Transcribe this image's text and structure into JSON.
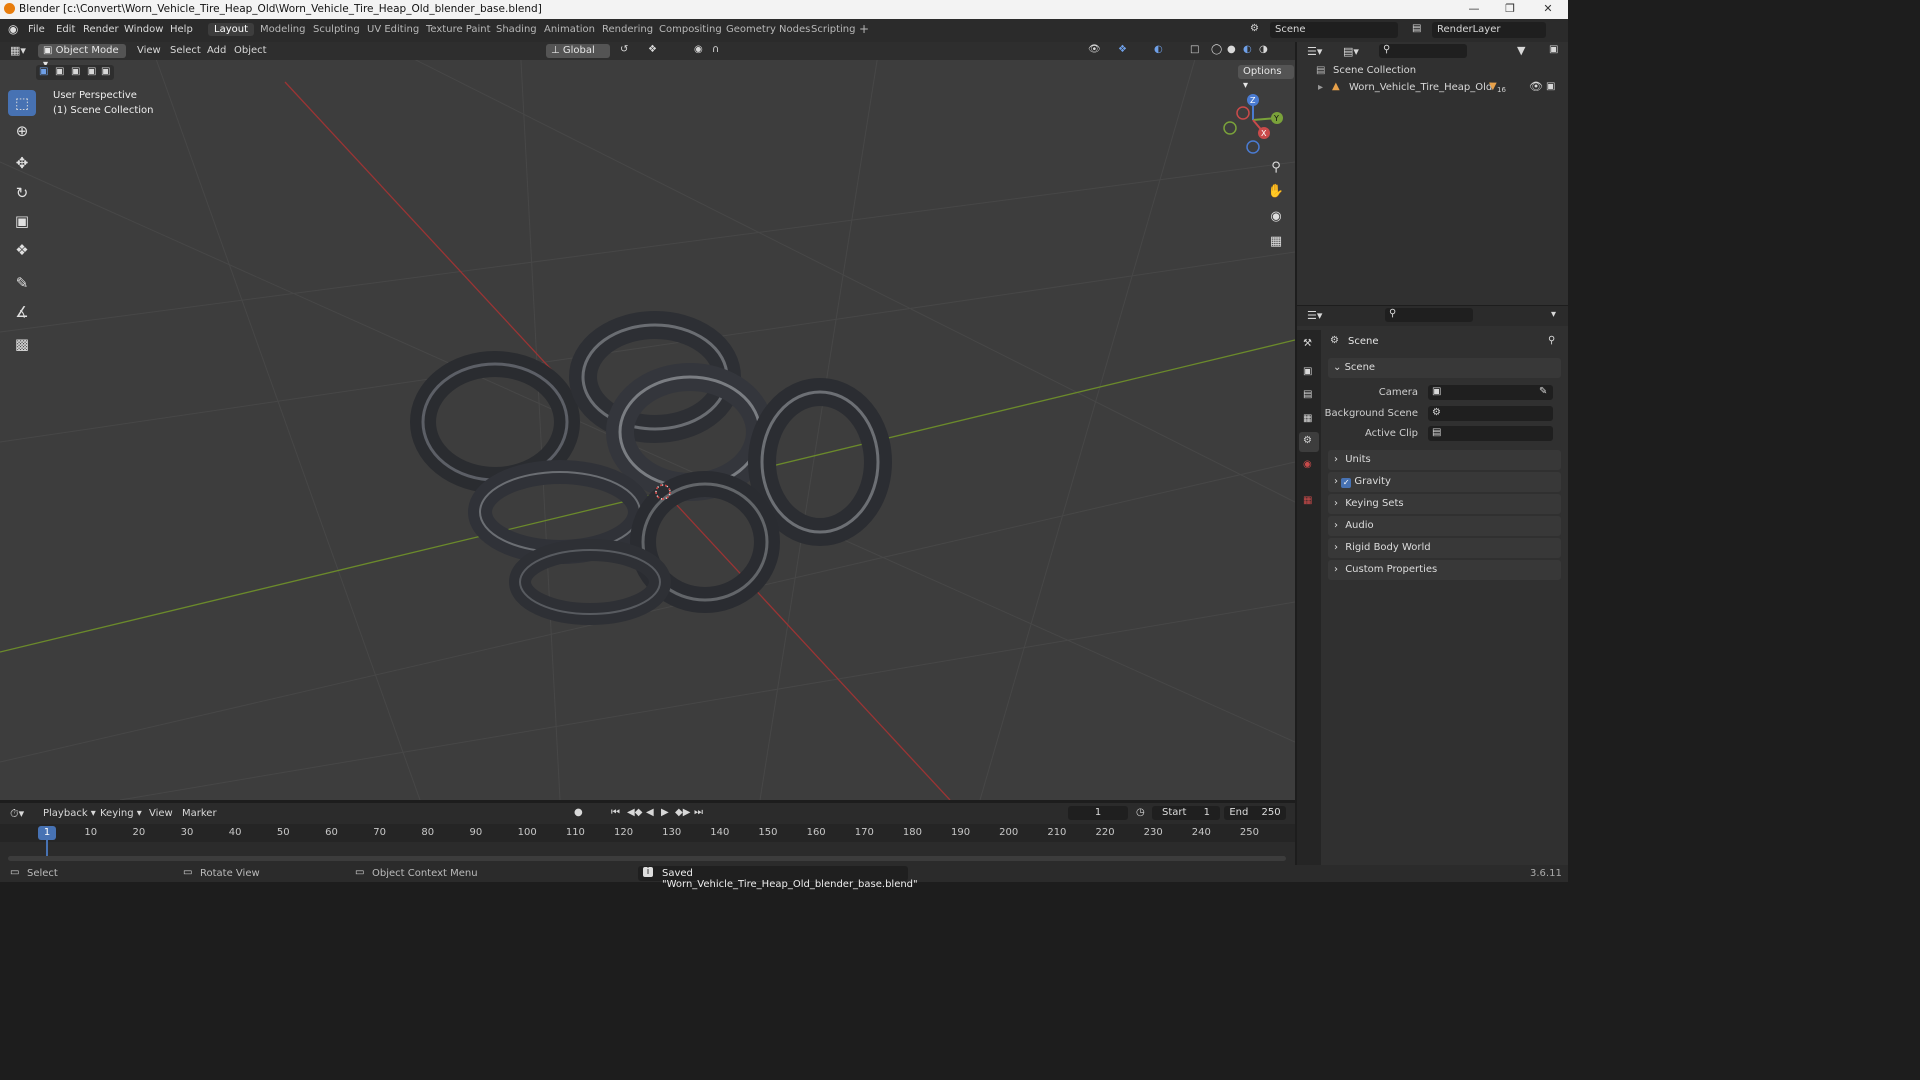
{
  "window": {
    "title": "Blender [c:\\Convert\\Worn_Vehicle_Tire_Heap_Old\\Worn_Vehicle_Tire_Heap_Old_blender_base.blend]"
  },
  "menu": [
    "File",
    "Edit",
    "Render",
    "Window",
    "Help"
  ],
  "workspaces": [
    "Layout",
    "Modeling",
    "Sculpting",
    "UV Editing",
    "Texture Paint",
    "Shading",
    "Animation",
    "Rendering",
    "Compositing",
    "Geometry Nodes",
    "Scripting"
  ],
  "workspace_add": "+",
  "scene_selector": "Scene",
  "view_layer": "RenderLayer",
  "viewport": {
    "mode": "Object Mode",
    "menus": [
      "View",
      "Select",
      "Add",
      "Object"
    ],
    "orientation": "Global",
    "options": "Options",
    "overlay_line1": "User Perspective",
    "overlay_line2": "(1) Scene Collection",
    "gizmo": {
      "x": "X",
      "y": "Y",
      "z": "Z"
    }
  },
  "outliner": {
    "root": "Scene Collection",
    "items": [
      {
        "name": "Worn_Vehicle_Tire_Heap_Old",
        "badge": "16"
      }
    ]
  },
  "properties": {
    "context_title": "Scene",
    "section": "Scene",
    "fields": [
      {
        "label": "Camera"
      },
      {
        "label": "Background Scene"
      },
      {
        "label": "Active Clip"
      }
    ],
    "panels": [
      "Units",
      "Gravity",
      "Keying Sets",
      "Audio",
      "Rigid Body World",
      "Custom Properties"
    ]
  },
  "timeline": {
    "menus": [
      "Playback",
      "Keying",
      "View",
      "Marker"
    ],
    "current_frame": "1",
    "start_label": "Start",
    "start": "1",
    "end_label": "End",
    "end": "250",
    "ticks": [
      "1",
      "10",
      "20",
      "30",
      "40",
      "50",
      "60",
      "70",
      "80",
      "90",
      "100",
      "110",
      "120",
      "130",
      "140",
      "150",
      "160",
      "170",
      "180",
      "190",
      "200",
      "210",
      "220",
      "230",
      "240",
      "250"
    ]
  },
  "status": {
    "select": "Select",
    "rotate": "Rotate View",
    "context": "Object Context Menu",
    "message": "Saved \"Worn_Vehicle_Tire_Heap_Old_blender_base.blend\"",
    "version": "3.6.11"
  },
  "colors": {
    "accent": "#4772b3",
    "x_axis": "#9b3434",
    "y_axis": "#6b8a2b",
    "viewport_bg": "#3d3d3d"
  }
}
